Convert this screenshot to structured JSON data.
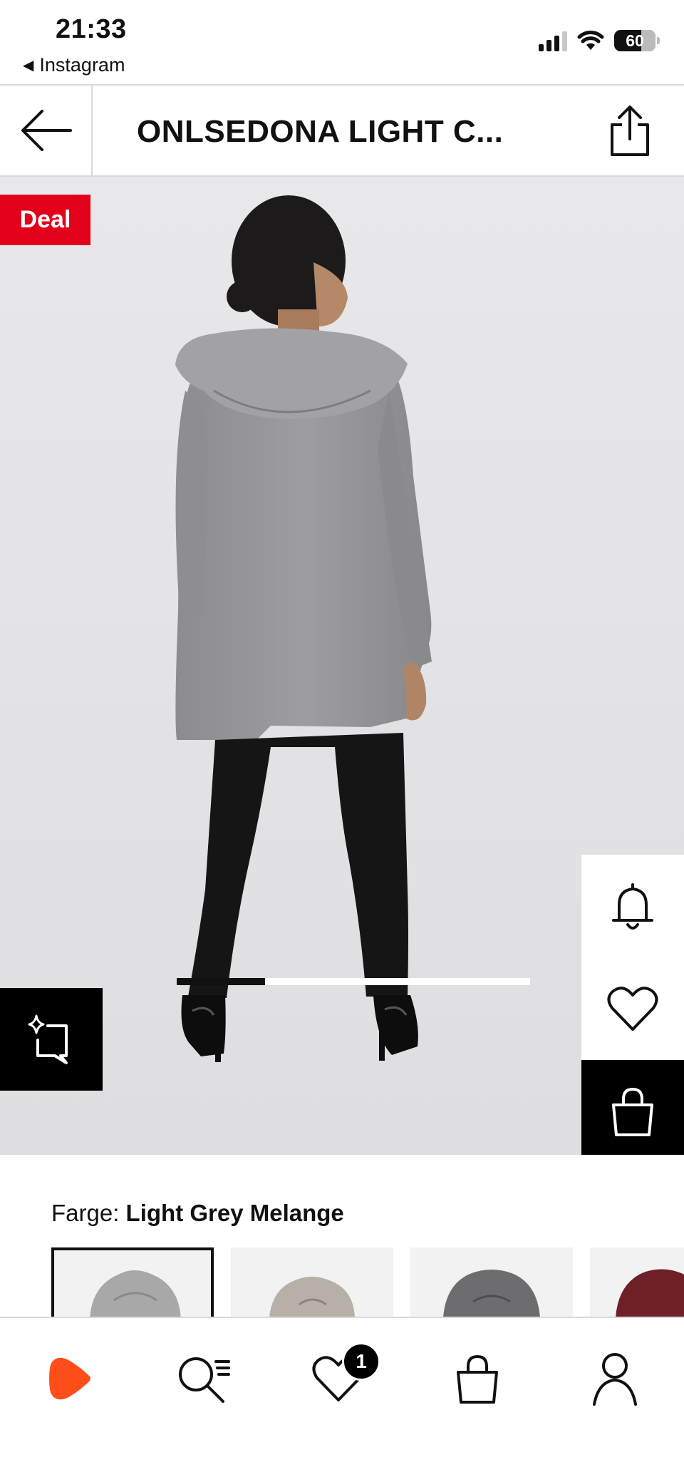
{
  "status_bar": {
    "time": "21:33",
    "back_app": "Instagram",
    "battery": "60"
  },
  "header": {
    "title": "ONLSEDONA LIGHT C..."
  },
  "gallery": {
    "deal_badge": "Deal",
    "image_position": 1,
    "image_count": 4
  },
  "product": {
    "color_label": "Farge:",
    "color_name": "Light Grey Melange",
    "swatches": [
      {
        "name": "light-grey-melange",
        "color": "#a8a8a8",
        "selected": true
      },
      {
        "name": "beige",
        "color": "#b8afa6",
        "selected": false
      },
      {
        "name": "dark-grey",
        "color": "#6d6d70",
        "selected": false
      },
      {
        "name": "burgundy",
        "color": "#6e1f28",
        "selected": false
      }
    ]
  },
  "bottom_nav": {
    "items": [
      "home",
      "search",
      "wishlist",
      "bag",
      "profile"
    ],
    "wishlist_count": "1"
  },
  "colors": {
    "accent": "#ff4e1a",
    "deal": "#e2001a",
    "background": "#e6e6e8"
  }
}
